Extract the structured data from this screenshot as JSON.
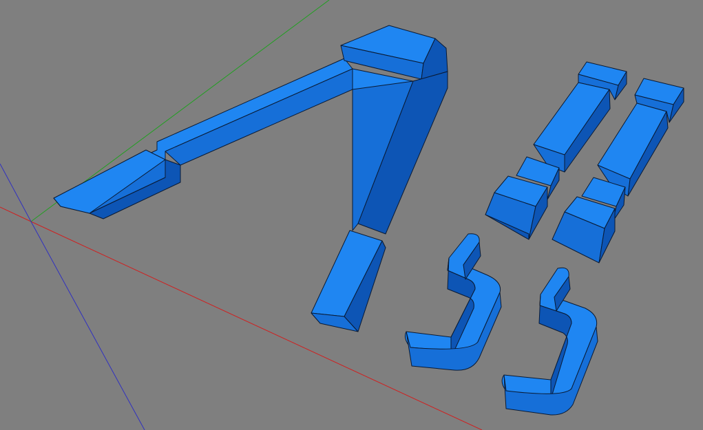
{
  "viewport": {
    "background": "#7f7f7f",
    "axes": {
      "x_color": "#d02020",
      "y_color": "#20a020",
      "z_color": "#3030c0"
    }
  },
  "material": {
    "face_light": "#1f86f2",
    "face_mid": "#166fd8",
    "face_dark": "#0d55b5",
    "edge": "#0a1a33"
  },
  "objects": [
    "triangle-frame-part",
    "bar-part-left",
    "bar-part-right",
    "hook-part-left",
    "hook-part-right"
  ]
}
